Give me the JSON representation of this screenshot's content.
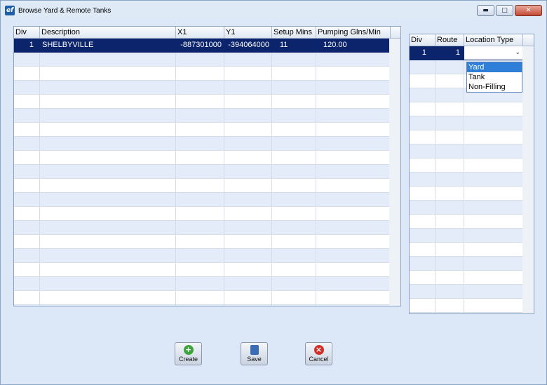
{
  "window": {
    "title": "Browse Yard & Remote Tanks",
    "app_icon": "ef"
  },
  "controls": {
    "minimize": "▬",
    "maximize": "□",
    "close": "✕"
  },
  "main_grid": {
    "columns": [
      "Div",
      "Description",
      "X1",
      "Y1",
      "Setup Mins",
      "Pumping Glns/Min"
    ],
    "rows": [
      {
        "div": "1",
        "description": "SHELBYVILLE",
        "x1": "-887301000",
        "y1": "-394064000",
        "setup": "11",
        "pumping": "120.00"
      }
    ]
  },
  "side_grid": {
    "columns": [
      "Div",
      "Route",
      "Location Type"
    ],
    "rows": [
      {
        "div": "1",
        "route": "1",
        "location_type": ""
      }
    ]
  },
  "location_type_options": [
    "Yard",
    "Tank",
    "Non-Filling"
  ],
  "buttons": {
    "create": "Create",
    "save": "Save",
    "cancel": "Cancel"
  }
}
